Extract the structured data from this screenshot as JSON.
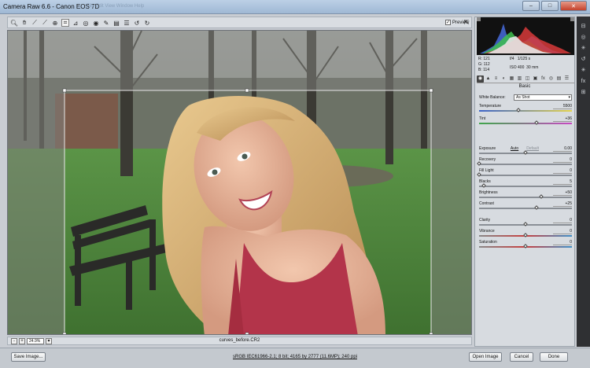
{
  "window": {
    "title": "Camera Raw 6.6  -  Canon EOS 7D",
    "menu_ghost": "File   Edit   View   Window   Help",
    "minimize": "–",
    "maximize": "□",
    "close": "✕"
  },
  "toolbar": {
    "tools": [
      {
        "name": "zoom-tool-icon",
        "glyph": "🔍︎"
      },
      {
        "name": "hand-tool-icon",
        "glyph": "✋︎"
      },
      {
        "name": "white-balance-tool-icon",
        "glyph": "⟋"
      },
      {
        "name": "color-sampler-tool-icon",
        "glyph": "⟋"
      },
      {
        "name": "targeted-adjustment-tool-icon",
        "glyph": "⊕"
      },
      {
        "name": "crop-tool-icon",
        "glyph": "⌗"
      },
      {
        "name": "straighten-tool-icon",
        "glyph": "⊿"
      },
      {
        "name": "spot-removal-tool-icon",
        "glyph": "◎"
      },
      {
        "name": "red-eye-tool-icon",
        "glyph": "◉"
      },
      {
        "name": "adjustment-brush-icon",
        "glyph": "✎"
      },
      {
        "name": "graduated-filter-icon",
        "glyph": "▤"
      },
      {
        "name": "preferences-icon",
        "glyph": "☰"
      },
      {
        "name": "rotate-ccw-icon",
        "glyph": "↺"
      },
      {
        "name": "rotate-cw-icon",
        "glyph": "↻"
      }
    ],
    "active_tool_index": 5,
    "preview_label": "Preview",
    "preview_checked": true,
    "fullscreen_glyph": "⇱"
  },
  "image": {
    "filename": "curves_before.CR2",
    "zoom": "24.9%",
    "zoom_minus": "-",
    "zoom_plus": "+",
    "zoom_dropdown": "▾"
  },
  "histogram": {
    "rgb": {
      "r": "121",
      "g": "112",
      "b": "114"
    },
    "exif": {
      "aperture": "f/4",
      "shutter": "1/125 s",
      "iso": "ISO 400",
      "focal": "30 mm"
    }
  },
  "panel": {
    "section_title": "Basic",
    "tabs": [
      "◉",
      "▲",
      "≡",
      "◐",
      "▦",
      "▥",
      "◫",
      "▣",
      "fx",
      "◎",
      "▤",
      "☰"
    ],
    "white_balance_label": "White Balance:",
    "white_balance_value": "As Shot",
    "temperature": {
      "label": "Temperature",
      "value": "5500",
      "level": 0.42
    },
    "tint": {
      "label": "Tint",
      "value": "+36",
      "level": 0.62
    },
    "auto_label": "Auto",
    "default_label": "Default",
    "exposure": {
      "label": "Exposure",
      "value": "0.00",
      "level": 0.5
    },
    "recovery": {
      "label": "Recovery",
      "value": "0",
      "level": 0.0
    },
    "fill_light": {
      "label": "Fill Light",
      "value": "0",
      "level": 0.0
    },
    "blacks": {
      "label": "Blacks",
      "value": "5",
      "level": 0.05
    },
    "brightness": {
      "label": "Brightness",
      "value": "+50",
      "level": 0.67
    },
    "contrast": {
      "label": "Contrast",
      "value": "+25",
      "level": 0.62
    },
    "clarity": {
      "label": "Clarity",
      "value": "0",
      "level": 0.5
    },
    "vibrance": {
      "label": "Vibrance",
      "value": "0",
      "level": 0.5
    },
    "saturation": {
      "label": "Saturation",
      "value": "0",
      "level": 0.5
    }
  },
  "footer": {
    "save_label": "Save Image...",
    "workflow_label": "sRGB IEC61966-2.1; 8 bit; 4165 by 2777 (11.6MP); 240 ppi",
    "open_label": "Open Image",
    "cancel_label": "Cancel",
    "done_label": "Done"
  },
  "right_strip": [
    "⊟",
    "◎",
    "✳",
    "↺",
    "✳",
    "fx",
    "⊞"
  ],
  "colors": {
    "accent": "#4a7fbf",
    "grass": "#4f8a3c",
    "top": "#c4414e"
  }
}
